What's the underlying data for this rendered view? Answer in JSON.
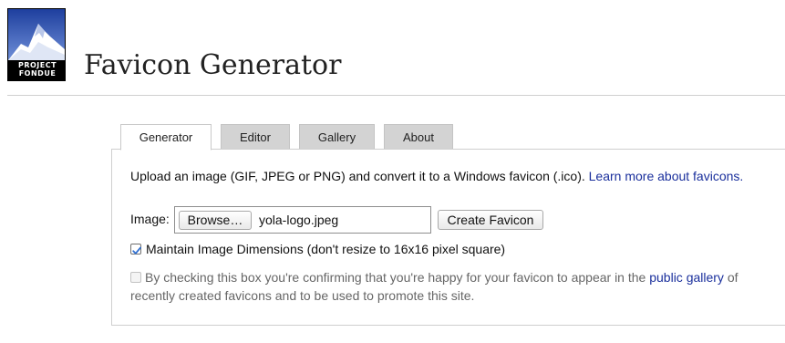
{
  "logo": {
    "line1": "PROJECT",
    "line2": "FONDUE"
  },
  "header": {
    "title": "Favicon Generator"
  },
  "tabs": [
    {
      "label": "Generator",
      "active": true
    },
    {
      "label": "Editor",
      "active": false
    },
    {
      "label": "Gallery",
      "active": false
    },
    {
      "label": "About",
      "active": false
    }
  ],
  "panel": {
    "intro_text": "Upload an image (GIF, JPEG or PNG) and convert it to a Windows favicon (.ico).",
    "learn_more_link": "Learn more about favicons.",
    "image_label": "Image:",
    "browse_label": "Browse…",
    "file_name": "yola-logo.jpeg",
    "create_label": "Create Favicon",
    "maintain_label": "Maintain Image Dimensions (don't resize to 16x16 pixel square)",
    "maintain_checked": true,
    "consent_part1": "By checking this box you're confirming that you're happy for your favicon to appear in the",
    "consent_link": "public gallery",
    "consent_part2": "of",
    "consent_part3": "recently created favicons and to be used to promote this site.",
    "consent_checked": false
  },
  "colors": {
    "link": "#1a2f9c",
    "checkbox_accent": "#2f6fd1",
    "tab_inactive": "#d3d3d3"
  }
}
